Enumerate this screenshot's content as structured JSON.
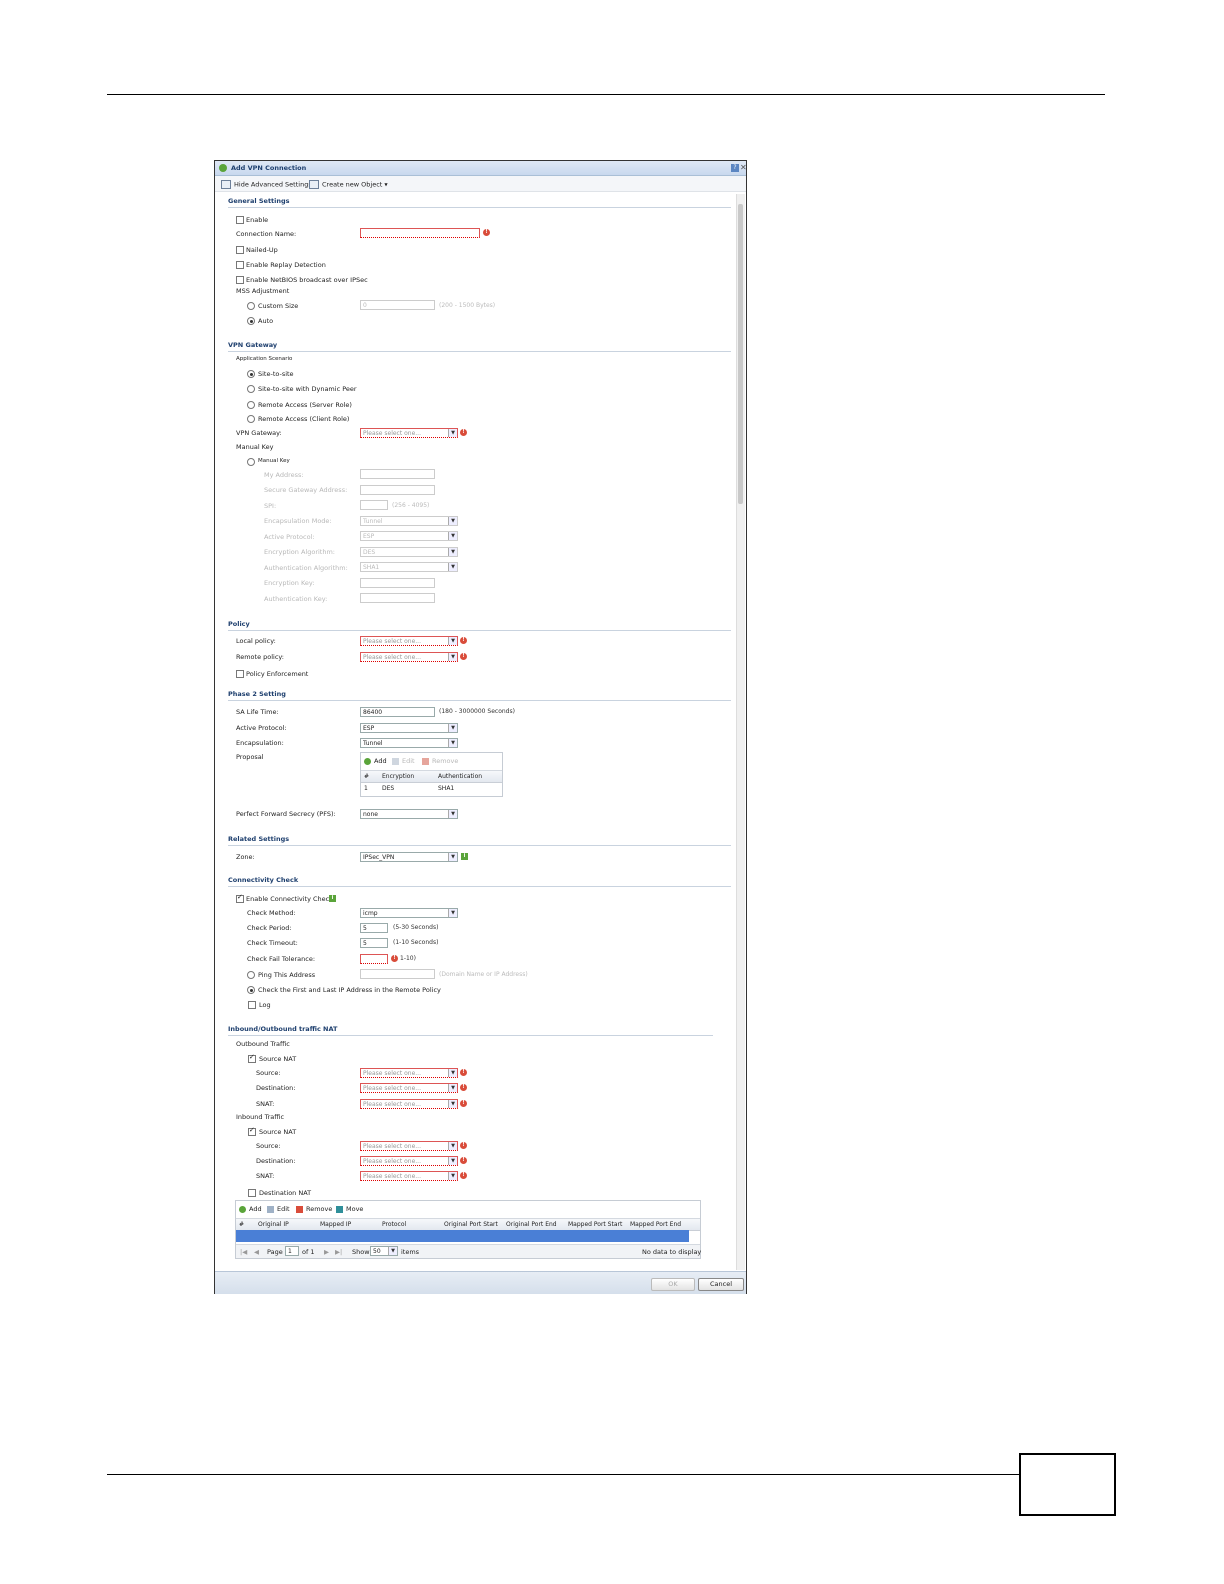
{
  "dialog": {
    "title": "Add VPN Connection",
    "toolbar": {
      "hide_advanced": "Hide Advanced Settings",
      "create_object": "Create new Object ▾"
    },
    "buttons": {
      "ok": "OK",
      "cancel": "Cancel"
    }
  },
  "general": {
    "heading": "General Settings",
    "enable": "Enable",
    "connection_name_label": "Connection Name:",
    "nailed_up": "Nailed-Up",
    "replay_detection": "Enable Replay Detection",
    "netbios": "Enable NetBIOS broadcast over IPSec",
    "mss_label": "MSS Adjustment",
    "custom_size": "Custom Size",
    "custom_size_value": "0",
    "custom_size_hint": "(200 - 1500 Bytes)",
    "auto": "Auto"
  },
  "gateway": {
    "heading": "VPN Gateway",
    "scenario_label": "Application Scenario",
    "scenarios": [
      "Site-to-site",
      "Site-to-site with Dynamic Peer",
      "Remote Access (Server Role)",
      "Remote Access (Client Role)"
    ],
    "vpn_gateway_label": "VPN Gateway:",
    "vpn_gateway_placeholder": "Please select one...",
    "manual_key_label": "Manual Key",
    "manual_key_radio": "Manual Key",
    "my_address": "My Address:",
    "secure_gw": "Secure Gateway Address:",
    "spi": "SPI:",
    "spi_hint": "(256 - 4095)",
    "encap_mode": "Encapsulation Mode:",
    "encap_mode_value": "Tunnel",
    "active_protocol": "Active Protocol:",
    "active_protocol_value": "ESP",
    "enc_alg": "Encryption Algorithm:",
    "enc_alg_value": "DES",
    "auth_alg": "Authentication Algorithm:",
    "auth_alg_value": "SHA1",
    "enc_key": "Encryption Key:",
    "auth_key": "Authentication Key:"
  },
  "policy": {
    "heading": "Policy",
    "local_label": "Local policy:",
    "remote_label": "Remote policy:",
    "placeholder": "Please select one...",
    "enforcement": "Policy Enforcement"
  },
  "phase2": {
    "heading": "Phase 2 Setting",
    "sa_label": "SA Life Time:",
    "sa_value": "86400",
    "sa_hint": "(180 - 3000000 Seconds)",
    "protocol_label": "Active Protocol:",
    "protocol_value": "ESP",
    "encap_label": "Encapsulation:",
    "encap_value": "Tunnel",
    "proposal_label": "Proposal",
    "proposal_tools": {
      "add": "Add",
      "edit": "Edit",
      "remove": "Remove"
    },
    "proposal_headers": [
      "#",
      "Encryption",
      "Authentication"
    ],
    "proposal_rows": [
      [
        "1",
        "DES",
        "SHA1"
      ]
    ],
    "pfs_label": "Perfect Forward Secrecy (PFS):",
    "pfs_value": "none"
  },
  "related": {
    "heading": "Related Settings",
    "zone_label": "Zone:",
    "zone_value": "IPSec_VPN"
  },
  "connectivity": {
    "heading": "Connectivity Check",
    "enable": "Enable Connectivity Check",
    "method_label": "Check Method:",
    "method_value": "icmp",
    "period_label": "Check Period:",
    "period_value": "5",
    "period_hint": "(5-30 Seconds)",
    "timeout_label": "Check Timeout:",
    "timeout_value": "5",
    "timeout_hint": "(1-10 Seconds)",
    "fail_label": "Check Fail Tolerance:",
    "fail_hint": "1-10)",
    "ping": "Ping This Address",
    "ping_hint": "(Domain Name or IP Address)",
    "first_last": "Check the First and Last IP Address in the Remote Policy",
    "log": "Log"
  },
  "nat": {
    "heading": "Inbound/Outbound traffic NAT",
    "outbound_label": "Outbound Traffic",
    "inbound_label": "Inbound Traffic",
    "source_nat": "Source NAT",
    "source": "Source:",
    "destination": "Destination:",
    "snat": "SNAT:",
    "placeholder": "Please select one...",
    "dest_nat": "Destination NAT",
    "tools": {
      "add": "Add",
      "edit": "Edit",
      "remove": "Remove",
      "move": "Move"
    },
    "headers": [
      "#",
      "Original IP",
      "Mapped IP",
      "Protocol",
      "Original Port Start",
      "Original Port End",
      "Mapped Port Start",
      "Mapped Port End"
    ],
    "pager": {
      "page": "Page",
      "page_value": "1",
      "of": "of 1",
      "show": "Show",
      "show_value": "50",
      "items": "items",
      "no_data": "No data to display"
    }
  },
  "colors": {
    "section": "#1e3f6e",
    "error": "#d94c3a",
    "highlight_row": "#4a7fd6"
  }
}
